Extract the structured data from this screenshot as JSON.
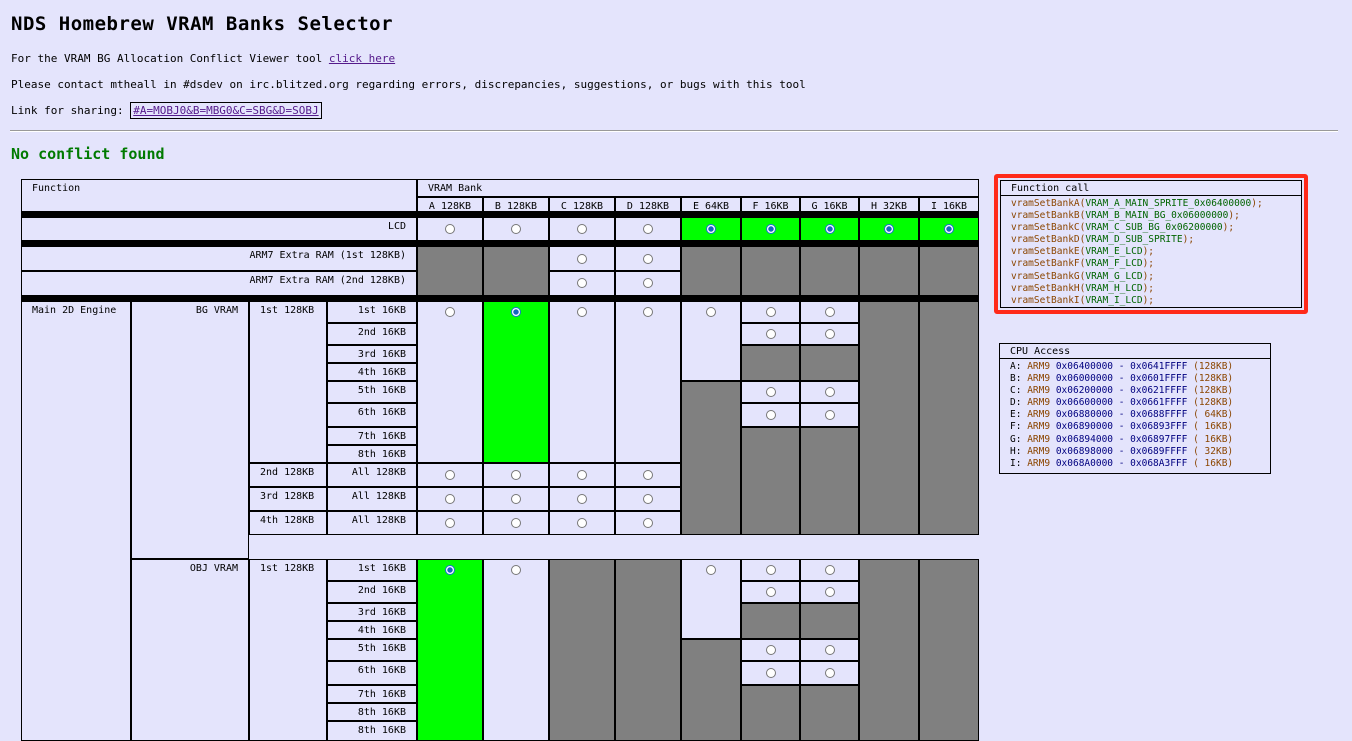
{
  "page": {
    "title": "NDS Homebrew VRAM Banks Selector",
    "bg_tool_prefix": "For the VRAM BG Allocation Conflict Viewer tool",
    "bg_tool_link": "click here",
    "contact": "Please contact mtheall in #dsdev on irc.blitzed.org regarding errors, discrepancies, suggestions, or bugs with this tool",
    "share_label": "Link for sharing:",
    "share_link": "#A=MOBJ0&B=MBG0&C=SBG&D=SOBJ",
    "status": "No conflict found"
  },
  "colors": {
    "background": "#e4e4fc",
    "selected_cell": "#00ff00",
    "unavailable_cell": "#808080",
    "status_text": "#007a00",
    "highlight_border": "#ff2a1a"
  },
  "table": {
    "function_header": "Function",
    "vram_bank_header": "VRAM Bank",
    "banks": [
      "A 128KB",
      "B 128KB",
      "C 128KB",
      "D 128KB",
      "E 64KB",
      "F 16KB",
      "G 16KB",
      "H 32KB",
      "I 16KB"
    ],
    "lcd": "LCD",
    "arm7_1": "ARM7 Extra RAM (1st 128KB)",
    "arm7_2": "ARM7 Extra RAM (2nd 128KB)",
    "main_2d": "Main 2D Engine",
    "bg_vram": "BG VRAM",
    "obj_vram": "OBJ VRAM",
    "k128": [
      "1st 128KB",
      "2nd 128KB",
      "3rd 128KB",
      "4th 128KB"
    ],
    "k16": [
      "1st 16KB",
      "2nd 16KB",
      "3rd 16KB",
      "4th 16KB",
      "5th 16KB",
      "6th 16KB",
      "7th 16KB",
      "8th 16KB"
    ],
    "all_128": "All 128KB"
  },
  "function_call": {
    "title": "Function call",
    "lines": [
      {
        "fn": "vramSetBankA(",
        "arg": "VRAM_A_MAIN_SPRITE_0x06400000",
        "end": ");"
      },
      {
        "fn": "vramSetBankB(",
        "arg": "VRAM_B_MAIN_BG_0x06000000",
        "end": ");"
      },
      {
        "fn": "vramSetBankC(",
        "arg": "VRAM_C_SUB_BG_0x06200000",
        "end": ");"
      },
      {
        "fn": "vramSetBankD(",
        "arg": "VRAM_D_SUB_SPRITE",
        "end": ");"
      },
      {
        "fn": "vramSetBankE(",
        "arg": "VRAM_E_LCD",
        "end": ");"
      },
      {
        "fn": "vramSetBankF(",
        "arg": "VRAM_F_LCD",
        "end": ");"
      },
      {
        "fn": "vramSetBankG(",
        "arg": "VRAM_G_LCD",
        "end": ");"
      },
      {
        "fn": "vramSetBankH(",
        "arg": "VRAM_H_LCD",
        "end": ");"
      },
      {
        "fn": "vramSetBankI(",
        "arg": "VRAM_I_LCD",
        "end": ");"
      }
    ]
  },
  "cpu_access": {
    "title": "CPU Access",
    "lines": [
      {
        "bank": "A:",
        "cpu": "ARM9",
        "range": "0x06400000 - 0x0641FFFF",
        "size": "(128KB)"
      },
      {
        "bank": "B:",
        "cpu": "ARM9",
        "range": "0x06000000 - 0x0601FFFF",
        "size": "(128KB)"
      },
      {
        "bank": "C:",
        "cpu": "ARM9",
        "range": "0x06200000 - 0x0621FFFF",
        "size": "(128KB)"
      },
      {
        "bank": "D:",
        "cpu": "ARM9",
        "range": "0x06600000 - 0x0661FFFF",
        "size": "(128KB)"
      },
      {
        "bank": "E:",
        "cpu": "ARM9",
        "range": "0x06880000 - 0x0688FFFF",
        "size": "( 64KB)"
      },
      {
        "bank": "F:",
        "cpu": "ARM9",
        "range": "0x06890000 - 0x06893FFF",
        "size": "( 16KB)"
      },
      {
        "bank": "G:",
        "cpu": "ARM9",
        "range": "0x06894000 - 0x06897FFF",
        "size": "( 16KB)"
      },
      {
        "bank": "H:",
        "cpu": "ARM9",
        "range": "0x06898000 - 0x0689FFFF",
        "size": "( 32KB)"
      },
      {
        "bank": "I:",
        "cpu": "ARM9",
        "range": "0x068A0000 - 0x068A3FFF",
        "size": "( 16KB)"
      }
    ]
  }
}
